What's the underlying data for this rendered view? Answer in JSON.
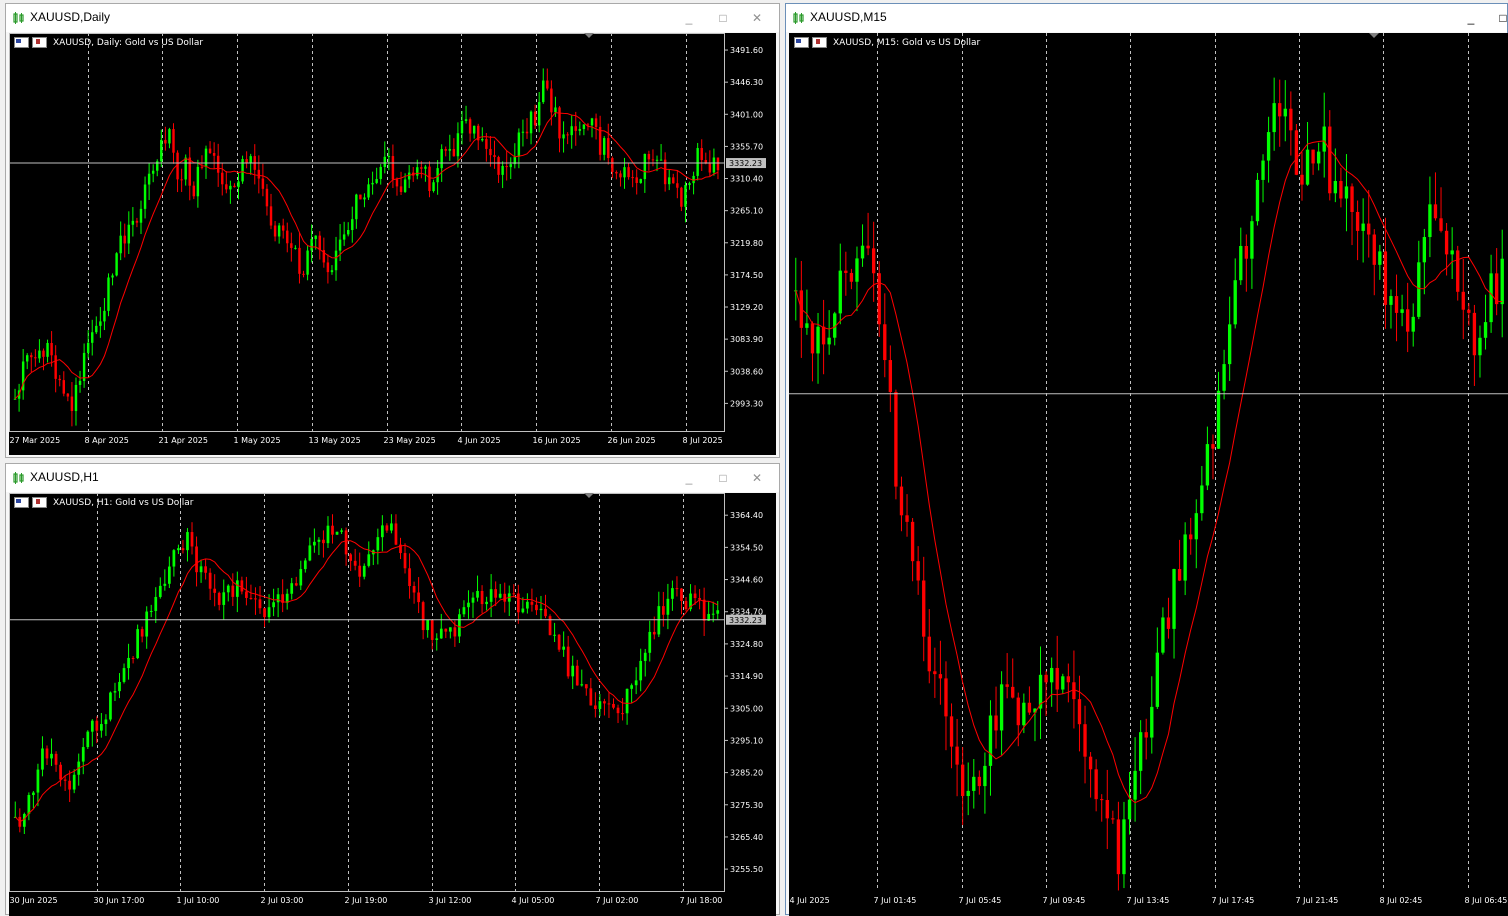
{
  "colors": {
    "bull": "#00ff00",
    "bear": "#ff0000",
    "ma": "#ff0000",
    "bid": "#c0c0c0",
    "grid": "#c0c0c0",
    "price_box": "#c0c0c0"
  },
  "windows": {
    "daily": {
      "title": "XAUUSD,Daily",
      "chart_title": "XAUUSD, Daily:  Gold vs US Dollar",
      "current_price": "3332.23",
      "price_axis": [
        "3491.60",
        "3446.30",
        "3401.00",
        "3355.70",
        "3310.40",
        "3265.10",
        "3219.80",
        "3174.50",
        "3129.20",
        "3083.90",
        "3038.60",
        "2993.30"
      ],
      "time_axis": [
        "27 Mar 2025",
        "8 Apr 2025",
        "21 Apr 2025",
        "1 May 2025",
        "13 May 2025",
        "23 May 2025",
        "4 Jun 2025",
        "16 Jun 2025",
        "26 Jun 2025",
        "8 Jul 2025"
      ]
    },
    "h1": {
      "title": "XAUUSD,H1",
      "chart_title": "XAUUSD, H1:  Gold vs US Dollar",
      "current_price": "3332.23",
      "price_axis": [
        "3364.40",
        "3354.50",
        "3344.60",
        "3334.70",
        "3324.80",
        "3314.90",
        "3305.00",
        "3295.10",
        "3285.20",
        "3275.30",
        "3265.40",
        "3255.50"
      ],
      "time_axis": [
        "30 Jun 2025",
        "30 Jun 17:00",
        "1 Jul 10:00",
        "2 Jul 03:00",
        "2 Jul 19:00",
        "3 Jul 12:00",
        "4 Jul 05:00",
        "7 Jul 02:00",
        "7 Jul 18:00"
      ]
    },
    "m15": {
      "title": "XAUUSD,M15",
      "chart_title": "XAUUSD, M15:  Gold vs US Dollar",
      "time_axis": [
        "4 Jul 2025",
        "7 Jul 01:45",
        "7 Jul 05:45",
        "7 Jul 09:45",
        "7 Jul 13:45",
        "7 Jul 17:45",
        "7 Jul 21:45",
        "8 Jul 02:45",
        "8 Jul 06:45"
      ]
    }
  },
  "window_buttons": {
    "minimize": "_",
    "maximize": "□",
    "close": "✕"
  },
  "chart_data": [
    {
      "type": "candlestick",
      "symbol": "XAUUSD",
      "timeframe": "Daily",
      "ylim": [
        2960,
        3510
      ],
      "ma_period": "20",
      "close_path": [
        3010,
        3040,
        3050,
        3060,
        3080,
        3020,
        3000,
        2980,
        3040,
        3080,
        3100,
        3140,
        3180,
        3220,
        3230,
        3245,
        3300,
        3330,
        3360,
        3390,
        3320,
        3330,
        3300,
        3340,
        3350,
        3320,
        3300,
        3290,
        3330,
        3350,
        3320,
        3280,
        3240,
        3250,
        3220,
        3180,
        3200,
        3240,
        3200,
        3180,
        3230,
        3250,
        3280,
        3300,
        3310,
        3320,
        3340,
        3310,
        3300,
        3320,
        3340,
        3300,
        3320,
        3360,
        3340,
        3380,
        3390,
        3350,
        3360,
        3330,
        3320,
        3340,
        3360,
        3380,
        3400,
        3440,
        3420,
        3380,
        3370,
        3390,
        3380,
        3390,
        3360,
        3350,
        3320,
        3310,
        3300,
        3320,
        3340,
        3350,
        3310,
        3300,
        3280,
        3320,
        3340,
        3330,
        3332
      ],
      "current_price": 3332.23
    },
    {
      "type": "candlestick",
      "symbol": "XAUUSD",
      "timeframe": "H1",
      "ylim": [
        3250,
        3370
      ],
      "close_path": [
        3268,
        3276,
        3280,
        3290,
        3292,
        3285,
        3280,
        3288,
        3296,
        3300,
        3305,
        3312,
        3318,
        3324,
        3330,
        3336,
        3340,
        3348,
        3355,
        3356,
        3350,
        3344,
        3340,
        3338,
        3342,
        3344,
        3340,
        3336,
        3334,
        3338,
        3342,
        3346,
        3350,
        3354,
        3358,
        3362,
        3360,
        3350,
        3346,
        3352,
        3358,
        3362,
        3356,
        3350,
        3340,
        3330,
        3328,
        3326,
        3328,
        3332,
        3336,
        3338,
        3340,
        3342,
        3340,
        3338,
        3336,
        3334,
        3332,
        3330,
        3324,
        3318,
        3312,
        3308,
        3306,
        3304,
        3302,
        3306,
        3312,
        3318,
        3326,
        3334,
        3338,
        3340,
        3338,
        3336,
        3334,
        3332
      ],
      "current_price": 3332.23
    },
    {
      "type": "candlestick",
      "symbol": "XAUUSD",
      "timeframe": "M15",
      "ylim": [
        3280,
        3370
      ],
      "close_path": [
        3342,
        3340,
        3338,
        3340,
        3344,
        3346,
        3348,
        3344,
        3335,
        3325,
        3318,
        3312,
        3305,
        3300,
        3296,
        3292,
        3290,
        3295,
        3298,
        3300,
        3298,
        3296,
        3300,
        3304,
        3302,
        3298,
        3294,
        3290,
        3286,
        3284,
        3288,
        3294,
        3300,
        3306,
        3312,
        3316,
        3320,
        3326,
        3332,
        3340,
        3346,
        3352,
        3358,
        3362,
        3360,
        3356,
        3358,
        3360,
        3356,
        3352,
        3354,
        3350,
        3346,
        3344,
        3342,
        3340,
        3346,
        3352,
        3350,
        3346,
        3340,
        3338,
        3342,
        3344
      ],
      "current_price": 3332.23
    }
  ]
}
